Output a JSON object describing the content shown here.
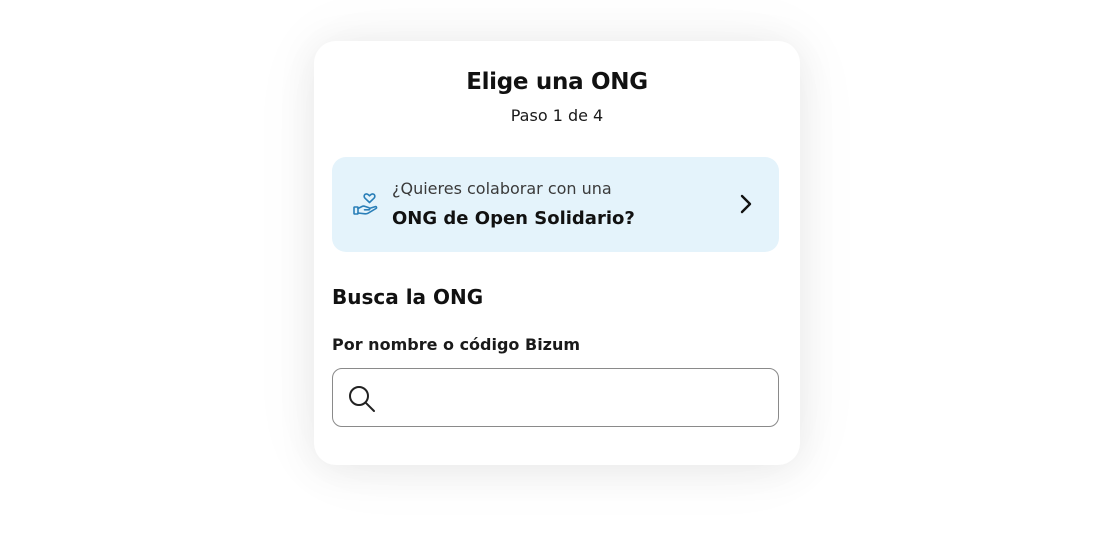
{
  "header": {
    "title": "Elige una ONG",
    "step": "Paso 1 de 4"
  },
  "promo": {
    "line1": "¿Quieres colaborar con una",
    "line2": "ONG de Open Solidario?",
    "icon": "hand-heart-icon",
    "chevron": "chevron-right-icon",
    "background_color": "#e4f3fb",
    "icon_color": "#2a7fb8"
  },
  "search": {
    "section_title": "Busca la ONG",
    "label": "Por nombre o código Bizum",
    "value": "",
    "placeholder": "",
    "icon": "search-icon"
  }
}
